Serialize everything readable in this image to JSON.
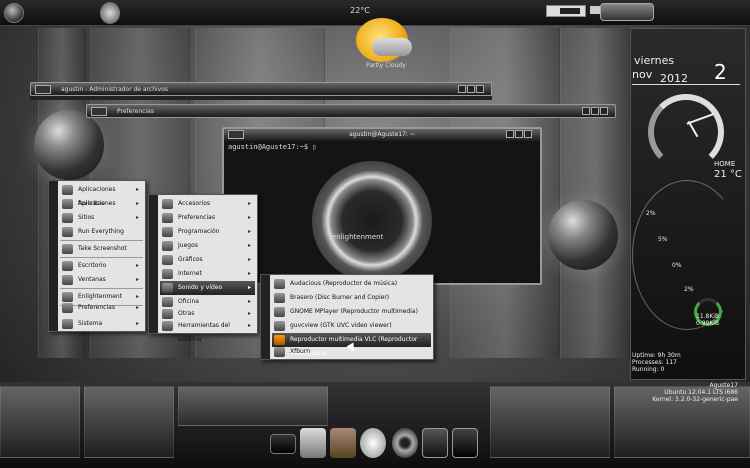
{
  "topbar": {
    "temperature": "22°C"
  },
  "weather": {
    "label": "Partly Cloudy"
  },
  "windows": {
    "file_manager_title": "agustin - Administrador de archivos",
    "preferences_title": "Preferencias",
    "terminal_title": "agustin@Aguste17: ~",
    "terminal_prompt": "agustin@Aguste17:~$ ▯"
  },
  "enlightenment_logo_text": "enlightenment",
  "main_menu": {
    "items": [
      {
        "label": "Aplicaciones favoritas",
        "icon": "star-icon",
        "submenu": true
      },
      {
        "label": "Aplicaciones",
        "icon": "apps-icon",
        "submenu": true
      },
      {
        "label": "Sitios",
        "icon": "places-icon",
        "submenu": true
      },
      {
        "label": "Run Everything",
        "icon": "run-icon",
        "submenu": false
      },
      {
        "label": "Take Screenshot",
        "icon": "camera-icon",
        "submenu": false
      },
      {
        "label": "Escritorio",
        "icon": "desktop-icon",
        "submenu": true
      },
      {
        "label": "Ventanas",
        "icon": "windows-icon",
        "submenu": true
      },
      {
        "label": "Enlightenment",
        "icon": "enlightenment-icon",
        "submenu": true
      },
      {
        "label": "Preferencias",
        "icon": "preferences-icon",
        "submenu": true
      },
      {
        "label": "Sistema",
        "icon": "system-icon",
        "submenu": true
      }
    ]
  },
  "apps_menu": {
    "items": [
      {
        "label": "Accesorios",
        "icon": "accessories-icon"
      },
      {
        "label": "Preferencias",
        "icon": "preferences-icon"
      },
      {
        "label": "Programación",
        "icon": "programming-icon"
      },
      {
        "label": "Juegos",
        "icon": "games-icon"
      },
      {
        "label": "Gráficos",
        "icon": "graphics-icon"
      },
      {
        "label": "Internet",
        "icon": "internet-icon"
      },
      {
        "label": "Sonido y vídeo",
        "icon": "sound-video-icon"
      },
      {
        "label": "Oficina",
        "icon": "office-icon"
      },
      {
        "label": "Otras",
        "icon": "other-icon"
      },
      {
        "label": "Herramientas del sistema",
        "icon": "system-tools-icon"
      }
    ]
  },
  "media_menu": {
    "items": [
      {
        "label": "Audacious (Reproductor de música)",
        "icon": "audacious-icon"
      },
      {
        "label": "Brasero (Disc Burner and Copier)",
        "icon": "brasero-icon"
      },
      {
        "label": "GNOME MPlayer (Reproductor multimedia)",
        "icon": "mplayer-icon"
      },
      {
        "label": "guvcview (GTK UVC video viewer)",
        "icon": "webcam-icon"
      },
      {
        "label": "Reproductor multimedia VLC (Reproductor multimedia)",
        "icon": "vlc-icon"
      },
      {
        "label": "Xfburn",
        "icon": "xfburn-icon"
      }
    ]
  },
  "clock": {
    "day": "viernes",
    "month": "nov",
    "year": "2012",
    "date": "2"
  },
  "home_weather": {
    "label": "HOME",
    "temp": "21 °C"
  },
  "gauges": {
    "p1": "2%",
    "p2": "5%",
    "p3": "0%",
    "p4": "2%"
  },
  "network": {
    "up": "11.8KiB",
    "down": "0.99KiB"
  },
  "system": {
    "uptime": "Uptime: 9h 30m",
    "processes": "Processes: 117",
    "running": "Running: 0"
  },
  "host": {
    "name": "Aguste17",
    "os": "Ubuntu 12.04.1 LTS i686",
    "kernel": "Kernel: 3.2.0-32-generic-pae"
  },
  "dock": {
    "items": [
      "monitor-icon",
      "tools-icon",
      "harp-icon",
      "bird-icon",
      "disc-icon",
      "screen-icon",
      "terminal-icon"
    ]
  },
  "colors": {
    "menu_bg": "#e4e4e4",
    "menu_highlight": "#333333",
    "accent_sun": "#f0b020",
    "net_ring": "#44aa44"
  }
}
